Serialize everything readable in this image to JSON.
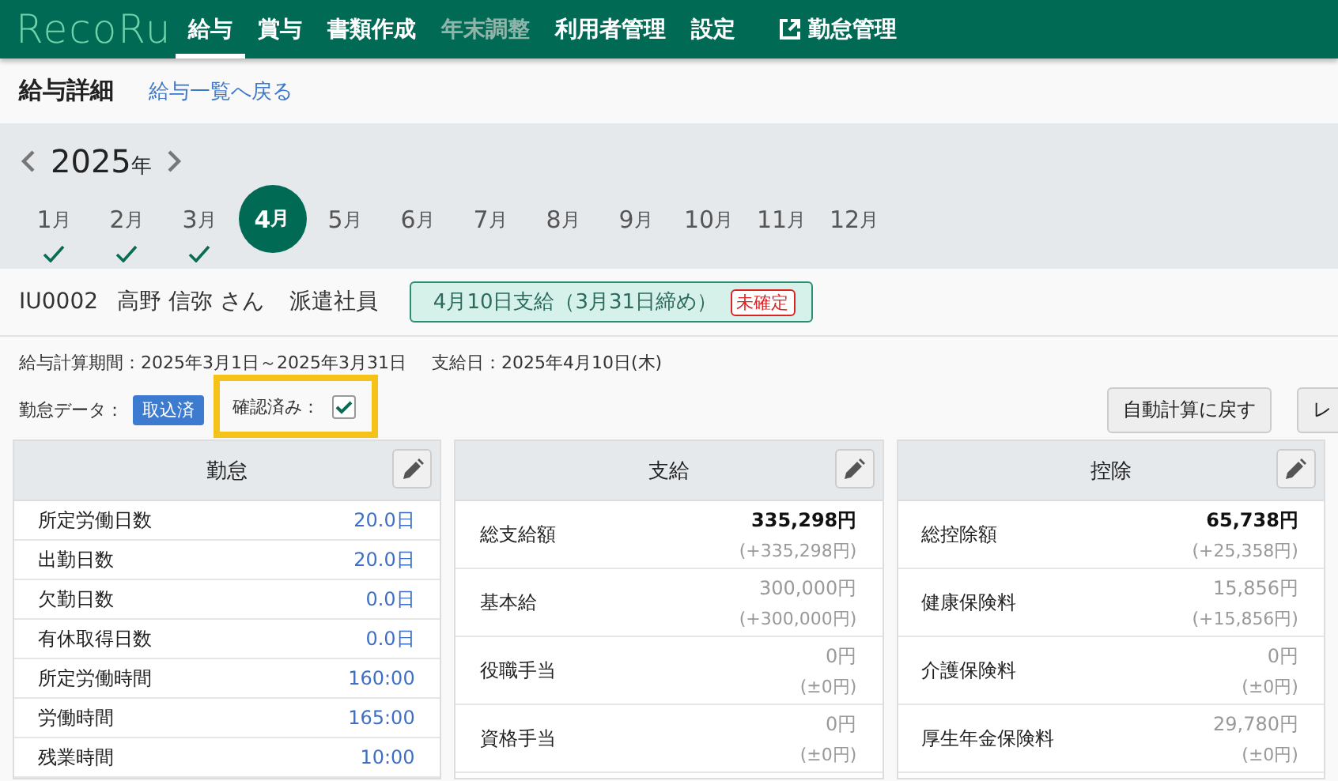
{
  "nav": {
    "logo": "RecoRu",
    "items": [
      {
        "label": "給与",
        "selected": true,
        "disabled": false,
        "kind": "page"
      },
      {
        "label": "賞与",
        "selected": false,
        "disabled": false,
        "kind": "page"
      },
      {
        "label": "書類作成",
        "selected": false,
        "disabled": false,
        "kind": "page"
      },
      {
        "label": "年末調整",
        "selected": false,
        "disabled": true,
        "kind": "page"
      },
      {
        "label": "利用者管理",
        "selected": false,
        "disabled": false,
        "kind": "page"
      },
      {
        "label": "設定",
        "selected": false,
        "disabled": false,
        "kind": "page"
      },
      {
        "label": "勤怠管理",
        "selected": false,
        "disabled": false,
        "kind": "external"
      }
    ]
  },
  "page": {
    "title": "給与詳細",
    "back_link": "給与一覧へ戻る"
  },
  "year": {
    "value": "2025",
    "unit": "年"
  },
  "months": [
    {
      "number": "1",
      "unit": "月",
      "done": true,
      "selected": false
    },
    {
      "number": "2",
      "unit": "月",
      "done": true,
      "selected": false
    },
    {
      "number": "3",
      "unit": "月",
      "done": true,
      "selected": false
    },
    {
      "number": "4",
      "unit": "月",
      "done": false,
      "selected": true
    },
    {
      "number": "5",
      "unit": "月",
      "done": false,
      "selected": false
    },
    {
      "number": "6",
      "unit": "月",
      "done": false,
      "selected": false
    },
    {
      "number": "7",
      "unit": "月",
      "done": false,
      "selected": false
    },
    {
      "number": "8",
      "unit": "月",
      "done": false,
      "selected": false
    },
    {
      "number": "9",
      "unit": "月",
      "done": false,
      "selected": false
    },
    {
      "number": "10",
      "unit": "月",
      "done": false,
      "selected": false
    },
    {
      "number": "11",
      "unit": "月",
      "done": false,
      "selected": false
    },
    {
      "number": "12",
      "unit": "月",
      "done": false,
      "selected": false
    }
  ],
  "employee": {
    "id": "IU0002",
    "name": "高野 信弥 さん",
    "type": "派遣社員",
    "pay_badge": "4月10日支給（3月31日締め）",
    "status": "未確定"
  },
  "period": {
    "calc": "給与計算期間：2025年3月1日～2025年3月31日",
    "pay_date": "支給日：2025年4月10日(木)"
  },
  "attendance_data": {
    "label": "勤怠データ：",
    "status": "取込済"
  },
  "confirmed": {
    "label": "確認済み：",
    "checked": true,
    "highlighted": true
  },
  "buttons": [
    "自動計算に戻す",
    "レ"
  ],
  "panels": [
    {
      "title": "勤怠",
      "kind": "simple",
      "rows": [
        {
          "label": "所定労働日数",
          "value": "20.0日"
        },
        {
          "label": "出勤日数",
          "value": "20.0日"
        },
        {
          "label": "欠勤日数",
          "value": "0.0日"
        },
        {
          "label": "有休取得日数",
          "value": "0.0日"
        },
        {
          "label": "所定労働時間",
          "value": "160:00"
        },
        {
          "label": "労働時間",
          "value": "165:00"
        },
        {
          "label": "残業時間",
          "value": "10:00"
        }
      ]
    },
    {
      "title": "支給",
      "kind": "amount",
      "rows": [
        {
          "label": "総支給額",
          "value": "335,298円",
          "diff": "(+335,298円)",
          "total": true
        },
        {
          "label": "基本給",
          "value": "300,000円",
          "diff": "(+300,000円)",
          "total": false
        },
        {
          "label": "役職手当",
          "value": "0円",
          "diff": "(±0円)",
          "total": false
        },
        {
          "label": "資格手当",
          "value": "0円",
          "diff": "(±0円)",
          "total": false
        }
      ]
    },
    {
      "title": "控除",
      "kind": "amount",
      "rows": [
        {
          "label": "総控除額",
          "value": "65,738円",
          "diff": "(+25,358円)",
          "total": true
        },
        {
          "label": "健康保険料",
          "value": "15,856円",
          "diff": "(+15,856円)",
          "total": false
        },
        {
          "label": "介護保険料",
          "value": "0円",
          "diff": "(±0円)",
          "total": false
        },
        {
          "label": "厚生年金保険料",
          "value": "29,780円",
          "diff": "(±0円)",
          "total": false
        }
      ]
    }
  ]
}
